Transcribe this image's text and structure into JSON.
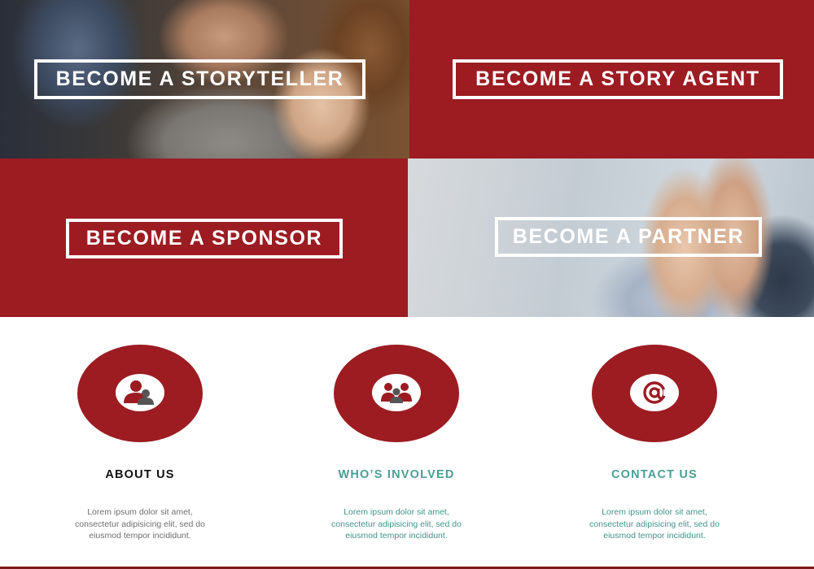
{
  "tiles": {
    "storyteller": {
      "label": "BECOME A STORYTELLER"
    },
    "story_agent": {
      "label": "BECOME A STORY AGENT"
    },
    "sponsor": {
      "label": "BECOME A SPONSOR"
    },
    "partner": {
      "label": "BECOME A PARTNER"
    }
  },
  "features": {
    "about": {
      "icon": "user-group-icon",
      "title": "ABOUT US",
      "lines": [
        "Lorem ipsum dolor sit amet,",
        "consectetur adipisicing elit, sed do",
        "eiusmod tempor incididunt."
      ]
    },
    "involved": {
      "icon": "people-icon",
      "title": "WHO’S INVOLVED",
      "lines": [
        "Lorem ipsum dolor sit amet,",
        "consectetur adipisicing elit, sed do",
        "eiusmod tempor incididunt."
      ]
    },
    "contact": {
      "icon": "at-sign-icon",
      "title": "CONTACT US",
      "lines": [
        "Lorem ipsum dolor sit amet,",
        "consectetur adipisicing elit, sed do",
        "eiusmod tempor incididunt."
      ]
    }
  },
  "colors": {
    "brand_red": "#9c1c22",
    "teal": "#4a9f95",
    "dark_gray": "#555555"
  }
}
